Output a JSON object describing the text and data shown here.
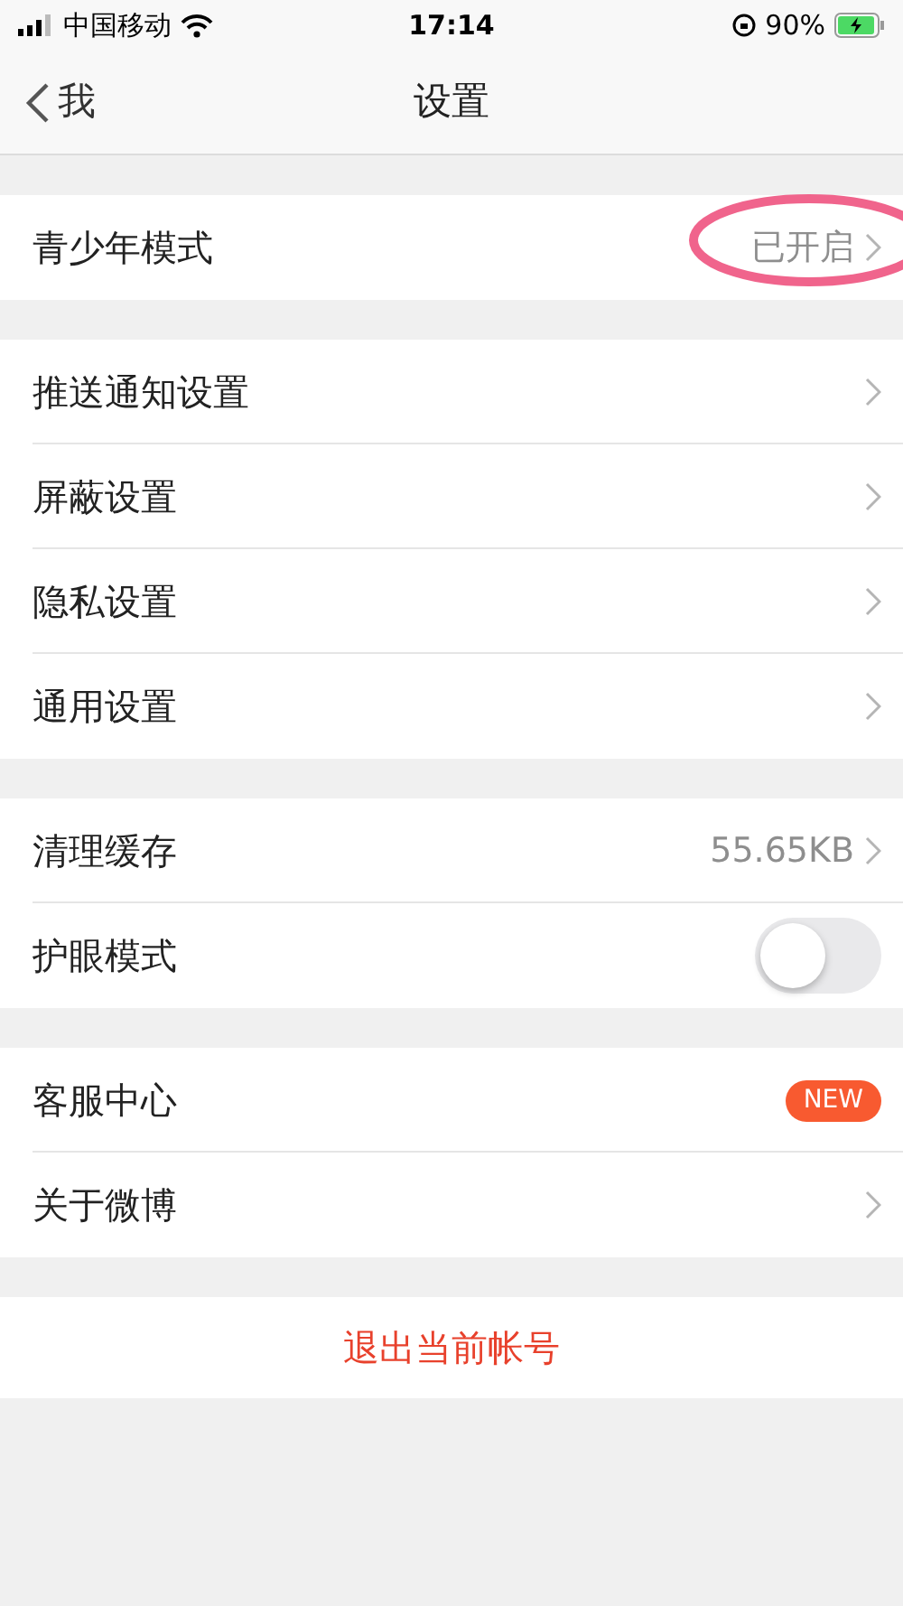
{
  "status_bar": {
    "carrier": "中国移动",
    "time": "17:14",
    "battery": "90%",
    "charging": true
  },
  "nav": {
    "back": "我",
    "title": "设置"
  },
  "groups": [
    {
      "rows": [
        {
          "label": "青少年模式",
          "kind": "value",
          "value": "已开启",
          "circled": true
        }
      ]
    },
    {
      "rows": [
        {
          "label": "推送通知设置",
          "kind": "link"
        },
        {
          "label": "屏蔽设置",
          "kind": "link"
        },
        {
          "label": "隐私设置",
          "kind": "link"
        },
        {
          "label": "通用设置",
          "kind": "link"
        }
      ]
    },
    {
      "rows": [
        {
          "label": "清理缓存",
          "kind": "value",
          "value": "55.65KB",
          "circled": false
        },
        {
          "label": "护眼模式",
          "kind": "toggle",
          "on": false
        }
      ]
    },
    {
      "rows": [
        {
          "label": "客服中心",
          "kind": "badge",
          "badge": "NEW"
        },
        {
          "label": "关于微博",
          "kind": "link"
        }
      ]
    }
  ],
  "logout": "退出当前帐号"
}
